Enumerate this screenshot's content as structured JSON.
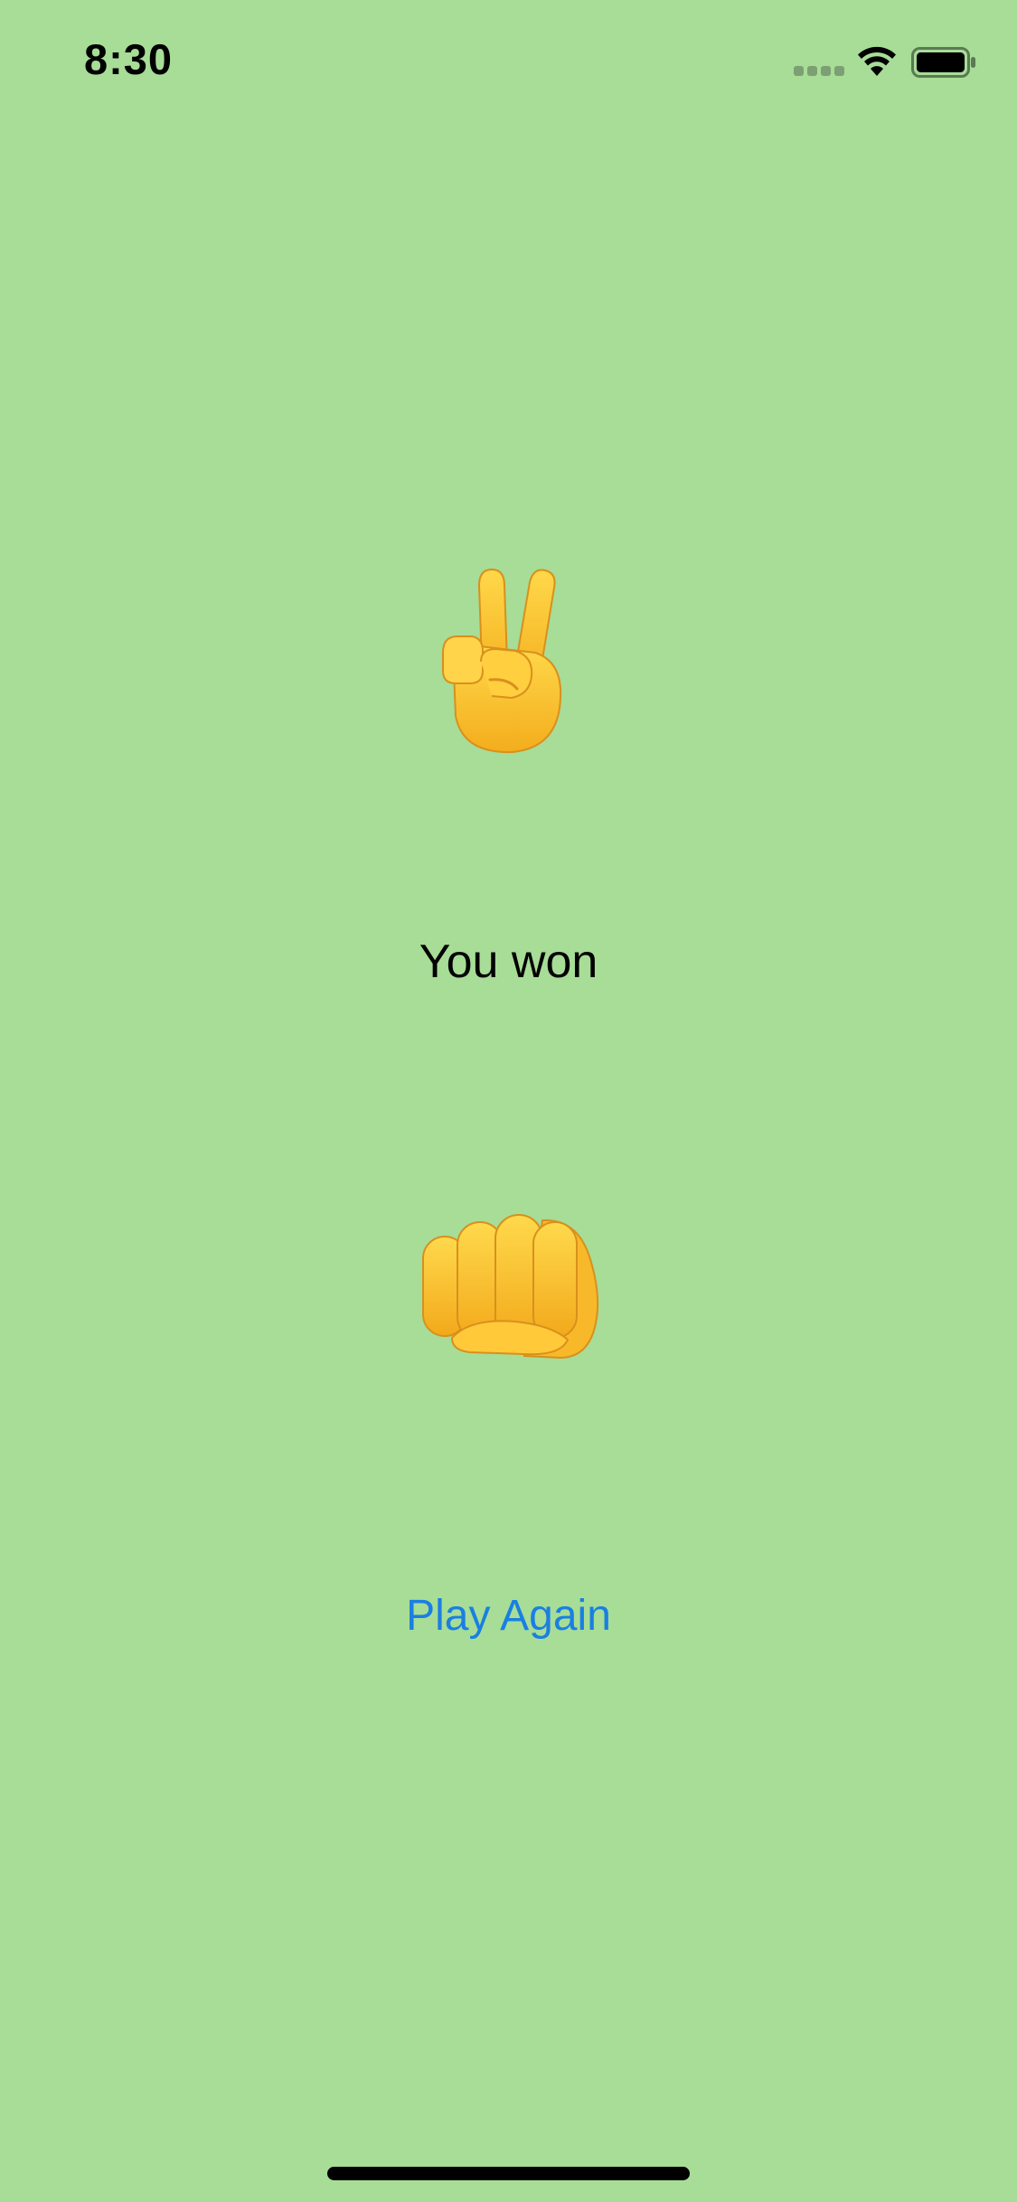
{
  "status_bar": {
    "time": "8:30",
    "signal_icon": "cellular-signal-icon",
    "wifi_icon": "wifi-icon",
    "battery_icon": "battery-icon"
  },
  "game": {
    "computer_choice": {
      "icon": "victory-hand-icon",
      "label": "scissors"
    },
    "result_text": "You won",
    "player_choice": {
      "icon": "fist-icon",
      "label": "rock"
    },
    "play_again_label": "Play Again"
  },
  "colors": {
    "background": "#a7dd97",
    "link": "#1a7fe2",
    "text": "#000000",
    "emoji_skin": "#f6c12e"
  }
}
